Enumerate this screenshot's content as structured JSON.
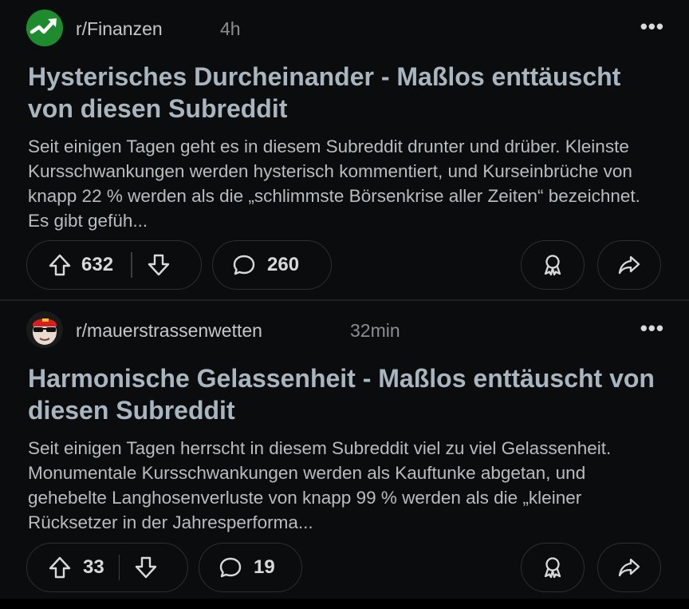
{
  "posts": [
    {
      "subreddit": "r/Finanzen",
      "time": "4h",
      "more_icon": "more-horizontal-icon",
      "title": "Hysterisches Durcheinander - Maßlos enttäuscht von diesen Subreddit",
      "body": "Seit einigen Tagen geht es in diesem Subreddit drunter und drüber. Kleinste Kursschwankungen werden hysterisch kommentiert, und Kurseinbrüche von knapp 22 % werden als die „schlimmste Börsenkrise aller Zeiten“ bezeichnet. Es gibt gefüh...",
      "upvotes": "632",
      "comments": "260",
      "icon": "trending-up-icon",
      "accent": "#1e8c2e"
    },
    {
      "subreddit": "r/mauerstrassenwetten",
      "time": "32min",
      "more_icon": "more-horizontal-icon",
      "title": "Harmonische Gelassenheit - Maßlos enttäuscht von diesen Subreddit",
      "body": "Seit einigen Tagen herrscht in diesem Subreddit viel zu viel Gelassenheit. Monumentale Kursschwankungen werden als Kauftunke abgetan, und gehebelte Langhosenverluste von knapp 99 % werden als die „kleiner Rücksetzer in der Jahresperforma...",
      "upvotes": "33",
      "comments": "19",
      "icon": "sunglasses-face-icon",
      "accent": "#e8e2da"
    }
  ]
}
